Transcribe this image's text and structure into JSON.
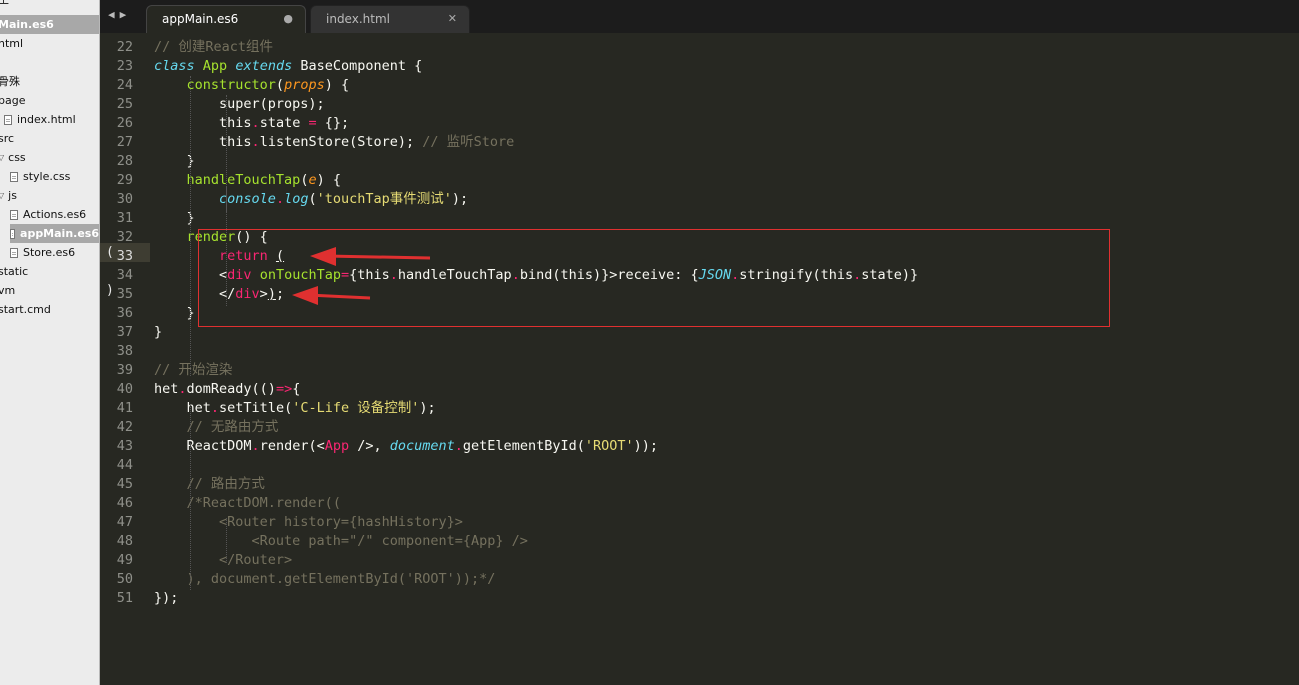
{
  "sidebar": {
    "items": [
      {
        "label": "王",
        "indent": 0,
        "kind": "text"
      },
      {
        "label": "Main.es6",
        "indent": 0,
        "kind": "text",
        "selected": true
      },
      {
        "label": "html",
        "indent": 0,
        "kind": "text"
      },
      {
        "label": "",
        "indent": 0,
        "kind": "text"
      },
      {
        "label": "骨殊",
        "indent": 0,
        "kind": "text"
      },
      {
        "label": "page",
        "indent": 0,
        "kind": "text"
      },
      {
        "label": "index.html",
        "indent": 1,
        "kind": "file"
      },
      {
        "label": "src",
        "indent": 0,
        "kind": "text"
      },
      {
        "label": "css",
        "indent": 0,
        "kind": "folder"
      },
      {
        "label": "style.css",
        "indent": 2,
        "kind": "file"
      },
      {
        "label": "js",
        "indent": 0,
        "kind": "folder"
      },
      {
        "label": "Actions.es6",
        "indent": 2,
        "kind": "file"
      },
      {
        "label": "appMain.es6",
        "indent": 2,
        "kind": "file",
        "selected": true
      },
      {
        "label": "Store.es6",
        "indent": 2,
        "kind": "file"
      },
      {
        "label": "static",
        "indent": 0,
        "kind": "text"
      },
      {
        "label": "vm",
        "indent": 0,
        "kind": "text"
      },
      {
        "label": "start.cmd",
        "indent": 0,
        "kind": "text"
      }
    ]
  },
  "tabs": [
    {
      "label": "appMain.es6",
      "active": true,
      "control": "●"
    },
    {
      "label": "index.html",
      "active": false,
      "control": "✕"
    }
  ],
  "nav": {
    "back": "◀",
    "forward": "▶"
  },
  "editor": {
    "current_line": 33,
    "fold_marks": [
      "(",
      ")"
    ],
    "lines": [
      {
        "n": 22,
        "html": "<span class='c'>// 创建React组件</span>"
      },
      {
        "n": 23,
        "html": "<span class='ik'>class</span> <span class='cls'>App</span> <span class='ik'>extends</span> BaseComponent {"
      },
      {
        "n": 24,
        "html": "    <span class='f'>constructor</span>(<span class='p'>props</span>) {"
      },
      {
        "n": 25,
        "html": "        super(props);"
      },
      {
        "n": 26,
        "html": "        this<span class='o'>.</span>state <span class='o'>=</span> {};"
      },
      {
        "n": 27,
        "html": "        this<span class='o'>.</span>listenStore(Store); <span class='c'>// 监听Store</span>"
      },
      {
        "n": 28,
        "html": "    }"
      },
      {
        "n": 29,
        "html": "    <span class='f'>handleTouchTap</span>(<span class='p'>e</span>) {"
      },
      {
        "n": 30,
        "html": "        <span class='ik'>console</span><span class='o'>.</span><span class='ik'>log</span>(<span class='s'>'touchTap事件测试'</span>);"
      },
      {
        "n": 31,
        "html": "    }"
      },
      {
        "n": 32,
        "html": "    <span class='f'>render</span>() {"
      },
      {
        "n": 33,
        "html": "        <span class='k'>return</span> <span class='und'>(</span>"
      },
      {
        "n": 34,
        "html": "        &lt;<span class='t'>div</span> <span class='a'>onTouchTap</span><span class='o'>=</span>{this<span class='o'>.</span>handleTouchTap<span class='o'>.</span>bind(this)}&gt;receive: {<span class='ik'>JSON</span><span class='o'>.</span>stringify(this<span class='o'>.</span>state)}"
      },
      {
        "n": 35,
        "html": "        &lt;/<span class='t'>div</span>&gt;<span class='und'>)</span>;"
      },
      {
        "n": 36,
        "html": "    }"
      },
      {
        "n": 37,
        "html": "}"
      },
      {
        "n": 38,
        "html": ""
      },
      {
        "n": 39,
        "html": "<span class='c'>// 开始渲染</span>"
      },
      {
        "n": 40,
        "html": "het<span class='o'>.</span>domReady(()<span class='o'>=&gt;</span>{"
      },
      {
        "n": 41,
        "html": "    het<span class='o'>.</span>setTitle(<span class='s'>'C-Life 设备控制'</span>);"
      },
      {
        "n": 42,
        "html": "    <span class='c'>// 无路由方式</span>"
      },
      {
        "n": 43,
        "html": "    ReactDOM<span class='o'>.</span>render(&lt;<span class='t'>App</span> /&gt;, <span class='ik'>document</span><span class='o'>.</span>getElementById(<span class='s'>'ROOT'</span>));"
      },
      {
        "n": 44,
        "html": ""
      },
      {
        "n": 45,
        "html": "    <span class='c'>// 路由方式</span>"
      },
      {
        "n": 46,
        "html": "    <span class='cm'>/*ReactDOM.render((</span>"
      },
      {
        "n": 47,
        "html": "<span class='cm'>        &lt;Router history={hashHistory}&gt;</span>"
      },
      {
        "n": 48,
        "html": "<span class='cm'>            &lt;Route path=\"/\" component={App} /&gt;</span>"
      },
      {
        "n": 49,
        "html": "<span class='cm'>        &lt;/Router&gt;</span>"
      },
      {
        "n": 50,
        "html": "<span class='cm'>    ), document.getElementById('ROOT'));*/</span>"
      },
      {
        "n": 51,
        "html": "});"
      }
    ]
  },
  "colors": {
    "background": "#272822",
    "comment": "#75715e",
    "keyword": "#f92672",
    "function": "#a6e22e",
    "string": "#e6db74",
    "builtin": "#66d9ef",
    "param": "#fd971f",
    "annotation": "#e03030"
  }
}
